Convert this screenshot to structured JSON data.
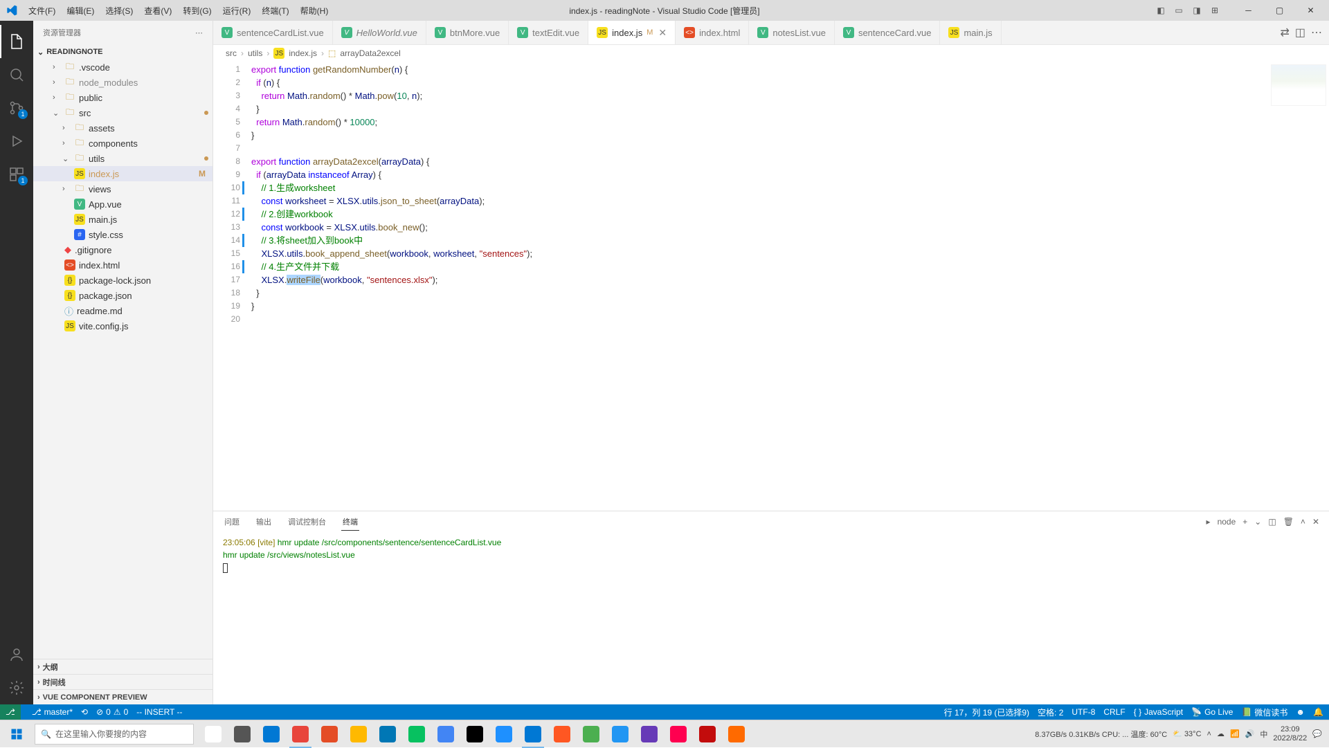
{
  "titlebar": {
    "menu": [
      "文件(F)",
      "编辑(E)",
      "选择(S)",
      "查看(V)",
      "转到(G)",
      "运行(R)",
      "终端(T)",
      "帮助(H)"
    ],
    "title": "index.js - readingNote - Visual Studio Code [管理员]"
  },
  "activitybar": {
    "badges": {
      "scm": "1",
      "run": "1"
    }
  },
  "sidebar": {
    "title": "资源管理器",
    "project": "READINGNOTE",
    "items": [
      {
        "type": "folder",
        "label": ".vscode",
        "depth": 1,
        "expanded": false
      },
      {
        "type": "folder",
        "label": "node_modules",
        "depth": 1,
        "expanded": false,
        "dim": true
      },
      {
        "type": "folder",
        "label": "public",
        "depth": 1,
        "expanded": false
      },
      {
        "type": "folder",
        "label": "src",
        "depth": 1,
        "expanded": true,
        "modDot": true
      },
      {
        "type": "folder",
        "label": "assets",
        "depth": 2,
        "expanded": false
      },
      {
        "type": "folder",
        "label": "components",
        "depth": 2,
        "expanded": false
      },
      {
        "type": "folder",
        "label": "utils",
        "depth": 2,
        "expanded": true,
        "modDot": true
      },
      {
        "type": "file",
        "label": "index.js",
        "depth": 2,
        "icon": "js",
        "selected": true,
        "badge": "M",
        "mod": true
      },
      {
        "type": "folder",
        "label": "views",
        "depth": 2,
        "expanded": false
      },
      {
        "type": "file",
        "label": "App.vue",
        "depth": 2,
        "icon": "vue"
      },
      {
        "type": "file",
        "label": "main.js",
        "depth": 2,
        "icon": "js"
      },
      {
        "type": "file",
        "label": "style.css",
        "depth": 2,
        "icon": "css"
      },
      {
        "type": "file",
        "label": ".gitignore",
        "depth": 1,
        "icon": "git"
      },
      {
        "type": "file",
        "label": "index.html",
        "depth": 1,
        "icon": "html"
      },
      {
        "type": "file",
        "label": "package-lock.json",
        "depth": 1,
        "icon": "json"
      },
      {
        "type": "file",
        "label": "package.json",
        "depth": 1,
        "icon": "json"
      },
      {
        "type": "file",
        "label": "readme.md",
        "depth": 1,
        "icon": "md"
      },
      {
        "type": "file",
        "label": "vite.config.js",
        "depth": 1,
        "icon": "js"
      }
    ],
    "sections": [
      "大纲",
      "时间线",
      "VUE COMPONENT PREVIEW"
    ]
  },
  "tabs": [
    {
      "label": "sentenceCardList.vue",
      "icon": "vue"
    },
    {
      "label": "HelloWorld.vue",
      "icon": "vue",
      "italic": true
    },
    {
      "label": "btnMore.vue",
      "icon": "vue"
    },
    {
      "label": "textEdit.vue",
      "icon": "vue"
    },
    {
      "label": "index.js",
      "icon": "js",
      "active": true,
      "suffix": "M",
      "close": true
    },
    {
      "label": "index.html",
      "icon": "html"
    },
    {
      "label": "notesList.vue",
      "icon": "vue"
    },
    {
      "label": "sentenceCard.vue",
      "icon": "vue"
    },
    {
      "label": "main.js",
      "icon": "js"
    }
  ],
  "breadcrumb": [
    "src",
    "utils",
    "index.js",
    "arrayData2excel"
  ],
  "code": {
    "lines": [
      {
        "n": 1
      },
      {
        "n": 2
      },
      {
        "n": 3
      },
      {
        "n": 4
      },
      {
        "n": 5
      },
      {
        "n": 6
      },
      {
        "n": 7
      },
      {
        "n": 8
      },
      {
        "n": 9
      },
      {
        "n": 10,
        "mod": true
      },
      {
        "n": 11
      },
      {
        "n": 12,
        "mod": true
      },
      {
        "n": 13
      },
      {
        "n": 14,
        "mod": true
      },
      {
        "n": 15
      },
      {
        "n": 16,
        "mod": true
      },
      {
        "n": 17
      },
      {
        "n": 18
      },
      {
        "n": 19
      },
      {
        "n": 20
      }
    ]
  },
  "panel": {
    "tabs": [
      "问题",
      "输出",
      "调试控制台",
      "终端"
    ],
    "active_tab": "终端",
    "shell_label": "node",
    "lines": [
      {
        "time": "23:05:06",
        "tag": "[vite]",
        "msg": "hmr update /src/components/sentence/sentenceCardList.vue"
      },
      {
        "msg2": "hmr update /src/views/notesList.vue"
      }
    ]
  },
  "statusbar": {
    "branch": "master*",
    "errors": "0",
    "warnings": "0",
    "vim": "-- INSERT --",
    "ln_col": "行 17，列 19 (已选择9)",
    "spaces": "空格: 2",
    "encoding": "UTF-8",
    "eol": "CRLF",
    "lang": "JavaScript",
    "live": "Go Live",
    "wechat": "微信读书",
    "bell": "notifications"
  },
  "taskbar": {
    "search_placeholder": "在这里输入你要搜的内容",
    "apps": [
      "cortana",
      "task-view",
      "edge",
      "chrome",
      "firefox",
      "files",
      "store",
      "wechat",
      "edge2",
      "notion",
      "xshell",
      "vscode",
      "player1",
      "player2",
      "mail",
      "douyin",
      "netease",
      "music",
      "ximalaya"
    ],
    "stats": "8.37GB/s  0.31KB/s  CPU: ... 温度: 60°C",
    "weather": "33°C",
    "time": "23:09",
    "date": "2022/8/22"
  }
}
